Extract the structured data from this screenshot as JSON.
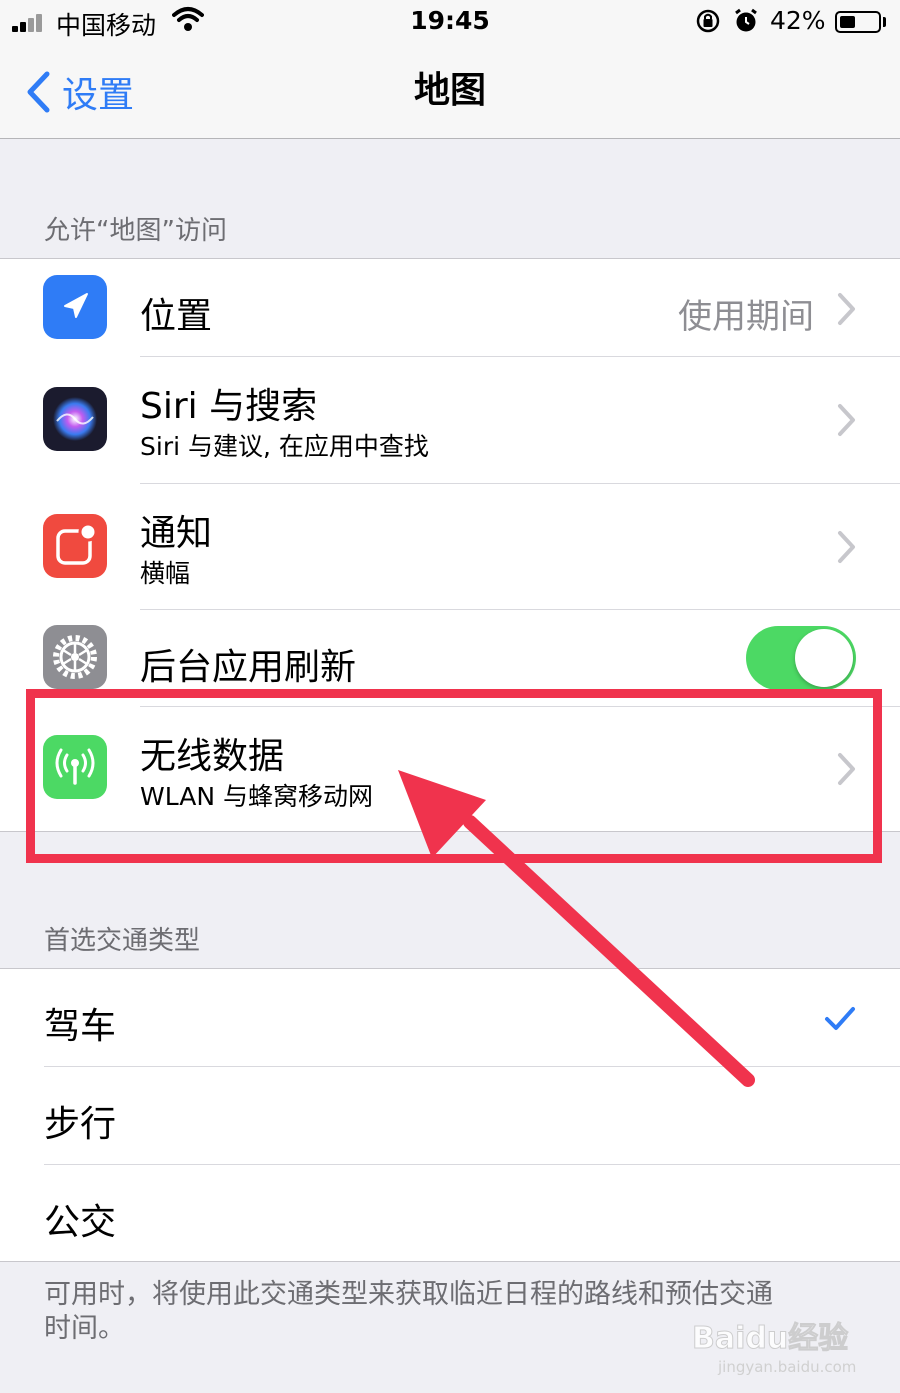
{
  "status_bar": {
    "carrier": "中国移动",
    "time": "19:45",
    "battery_percent": "42%",
    "battery_level": 0.42
  },
  "nav": {
    "back_label": "设置",
    "title": "地图"
  },
  "access_section": {
    "header": "允许“地图”访问",
    "items": [
      {
        "title": "位置",
        "value": "使用期间",
        "icon": "location-arrow-icon"
      },
      {
        "title": "Siri 与搜索",
        "subtitle": "Siri 与建议, 在应用中查找",
        "icon": "siri-icon"
      },
      {
        "title": "通知",
        "subtitle": "横幅",
        "icon": "notifications-icon"
      },
      {
        "title": "后台应用刷新",
        "toggle_on": true,
        "icon": "gear-icon"
      },
      {
        "title": "无线数据",
        "subtitle": "WLAN 与蜂窝移动网",
        "icon": "antenna-icon"
      }
    ]
  },
  "transport_section": {
    "header": "首选交通类型",
    "items": [
      {
        "title": "驾车",
        "selected": true
      },
      {
        "title": "步行",
        "selected": false
      },
      {
        "title": "公交",
        "selected": false
      }
    ],
    "footer": "可用时，将使用此交通类型来获取临近日程的路线和预估交通时间。"
  },
  "watermark": {
    "brand": "Baidu经验",
    "url": "jingyan.baidu.com"
  },
  "colors": {
    "ios_blue": "#2f7cf6",
    "toggle_green": "#4cd964",
    "annotation_red": "#f0334d",
    "cellular_green": "#4cd964"
  }
}
